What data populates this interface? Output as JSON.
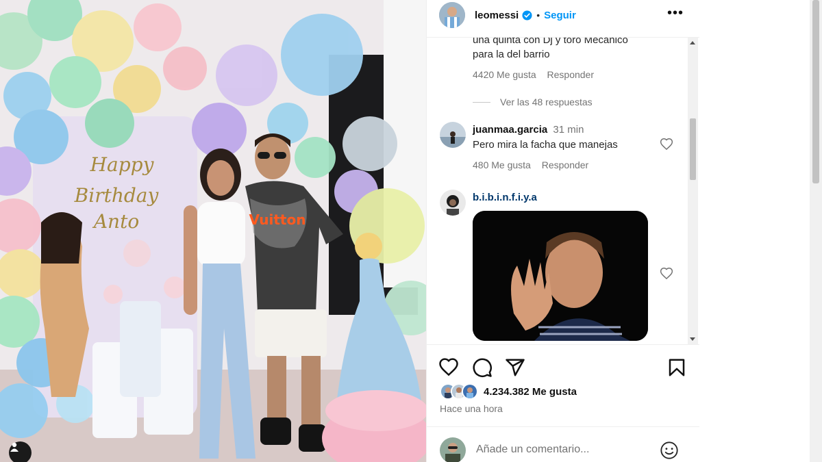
{
  "post": {
    "author": "leomessi",
    "follow_label": "Seguir",
    "separator": "•",
    "more_label": "•••",
    "photo_text": {
      "banner_line1": "Happy",
      "banner_line2": "Birthday",
      "banner_line3": "Anto",
      "shirt_text": "Vuitton"
    }
  },
  "comments": {
    "partial": {
      "line1": "una quinta con Dj y toro Mecánico",
      "line2": "para la del barrio",
      "likes": "4420 Me gusta",
      "reply": "Responder",
      "view_replies": "Ver las 48 respuestas"
    },
    "comment2": {
      "user": "juanmaa.garcia",
      "time": "31 min",
      "text": "Pero mira la facha que manejas",
      "likes": "480 Me gusta",
      "reply": "Responder"
    },
    "comment3": {
      "user": "b.i.b.i.n.f.i.y.a"
    }
  },
  "actions": {
    "likes_count": "4.234.382 Me gusta",
    "time_ago": "Hace una hora"
  },
  "add_comment": {
    "placeholder": "Añade un comentario..."
  },
  "colors": {
    "link_blue": "#0095f6",
    "muted": "#737373",
    "text": "#262626"
  },
  "icons": [
    "heart-icon",
    "comment-icon",
    "share-icon",
    "bookmark-icon",
    "emoji-icon",
    "verified-icon",
    "more-icon",
    "user-tag-icon"
  ]
}
